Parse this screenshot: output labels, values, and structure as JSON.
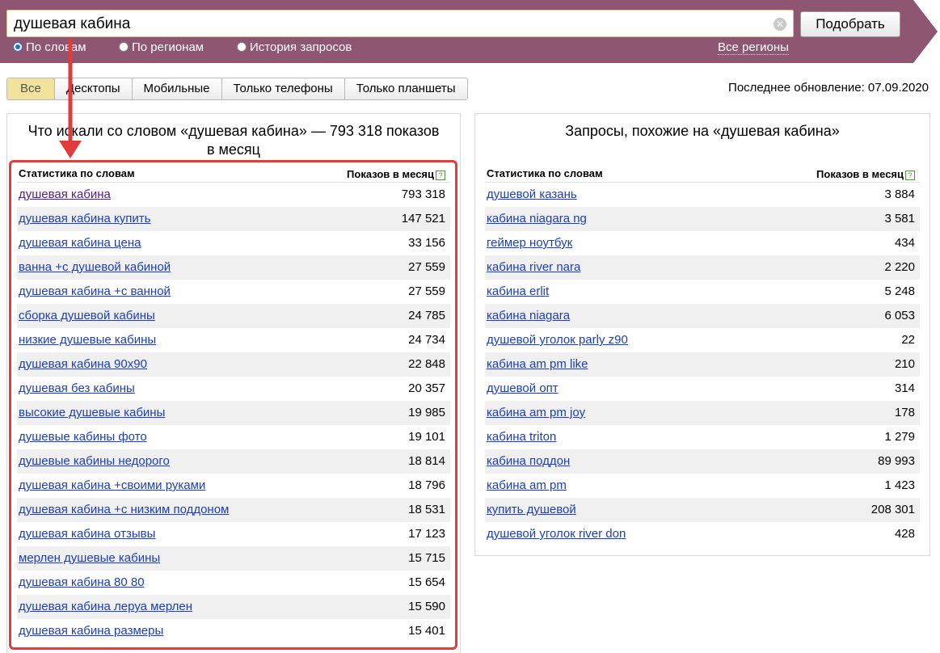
{
  "search": {
    "value": "душевая кабина",
    "clear_icon": "clear-icon",
    "submit_label": "Подобрать"
  },
  "modes": [
    {
      "label": "По словам",
      "checked": true
    },
    {
      "label": "По регионам",
      "checked": false
    },
    {
      "label": "История запросов",
      "checked": false
    }
  ],
  "regions_link": "Все регионы",
  "device_tabs": [
    "Все",
    "Десктопы",
    "Мобильные",
    "Только телефоны",
    "Только планшеты"
  ],
  "active_tab": "Все",
  "last_update": "Последнее обновление: 07.09.2020",
  "colors": {
    "header_bg": "#8e5670",
    "link": "#1a3dc1",
    "highlight": "#e23b3b",
    "active_tab": "#f2e39c"
  },
  "left_panel": {
    "title": "Что искали со словом «душевая кабина» — 793 318 показов в месяц",
    "col_words": "Статистика по словам",
    "col_count": "Показов в месяц",
    "help_icon": "help-icon",
    "rows": [
      {
        "phrase": "душевая кабина",
        "count": "793 318"
      },
      {
        "phrase": "душевая кабина купить",
        "count": "147 521"
      },
      {
        "phrase": "душевая кабина цена",
        "count": "33 156"
      },
      {
        "phrase": "ванна +с душевой кабиной",
        "count": "27 559"
      },
      {
        "phrase": "душевая кабина +с ванной",
        "count": "27 559"
      },
      {
        "phrase": "сборка душевой кабины",
        "count": "24 785"
      },
      {
        "phrase": "низкие душевые кабины",
        "count": "24 734"
      },
      {
        "phrase": "душевая кабина 90х90",
        "count": "22 848"
      },
      {
        "phrase": "душевая без кабины",
        "count": "20 357"
      },
      {
        "phrase": "высокие душевые кабины",
        "count": "19 985"
      },
      {
        "phrase": "душевые кабины фото",
        "count": "19 101"
      },
      {
        "phrase": "душевые кабины недорого",
        "count": "18 814"
      },
      {
        "phrase": "душевая кабина +своими руками",
        "count": "18 796"
      },
      {
        "phrase": "душевая кабина +с низким поддоном",
        "count": "18 531"
      },
      {
        "phrase": "душевая кабина отзывы",
        "count": "17 123"
      },
      {
        "phrase": "мерлен душевые кабины",
        "count": "15 715"
      },
      {
        "phrase": "душевая кабина 80 80",
        "count": "15 654"
      },
      {
        "phrase": "душевая кабина леруа мерлен",
        "count": "15 590"
      },
      {
        "phrase": "душевая кабина размеры",
        "count": "15 401"
      }
    ]
  },
  "right_panel": {
    "title": "Запросы, похожие на «душевая кабина»",
    "col_words": "Статистика по словам",
    "col_count": "Показов в месяц",
    "help_icon": "help-icon",
    "rows": [
      {
        "phrase": "душевой казань",
        "count": "3 884"
      },
      {
        "phrase": "кабина niagara ng",
        "count": "3 581"
      },
      {
        "phrase": "геймер ноутбук",
        "count": "434"
      },
      {
        "phrase": "кабина river nara",
        "count": "2 220"
      },
      {
        "phrase": "кабина erlit",
        "count": "5 248"
      },
      {
        "phrase": "кабина niagara",
        "count": "6 053"
      },
      {
        "phrase": "душевой уголок parly z90",
        "count": "22"
      },
      {
        "phrase": "кабина am pm like",
        "count": "210"
      },
      {
        "phrase": "душевой опт",
        "count": "314"
      },
      {
        "phrase": "кабина am pm joy",
        "count": "178"
      },
      {
        "phrase": "кабина triton",
        "count": "1 279"
      },
      {
        "phrase": "кабина поддон",
        "count": "89 993"
      },
      {
        "phrase": "кабина am pm",
        "count": "1 423"
      },
      {
        "phrase": "купить душевой",
        "count": "208 301"
      },
      {
        "phrase": "душевой уголок river don",
        "count": "428"
      }
    ]
  }
}
